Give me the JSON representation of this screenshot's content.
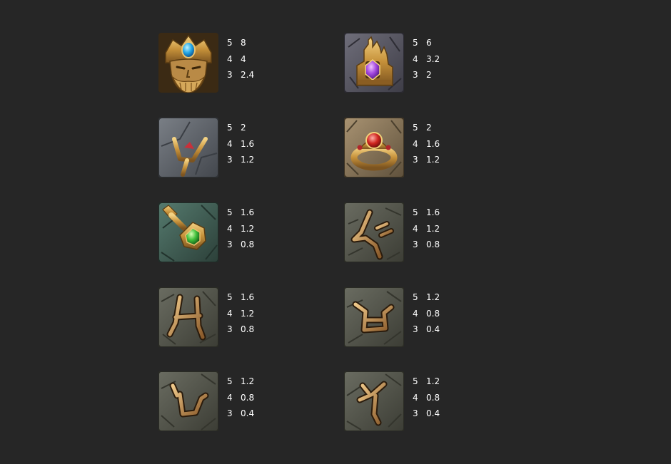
{
  "symbols": [
    {
      "icon": "poseidon-head-icon",
      "color": "#c9973a",
      "payouts": [
        {
          "count": "5",
          "value": "8"
        },
        {
          "count": "4",
          "value": "4"
        },
        {
          "count": "3",
          "value": "2.4"
        }
      ]
    },
    {
      "icon": "purple-gem-crown-icon",
      "color": "#9b5bd6",
      "payouts": [
        {
          "count": "5",
          "value": "6"
        },
        {
          "count": "4",
          "value": "3.2"
        },
        {
          "count": "3",
          "value": "2"
        }
      ]
    },
    {
      "icon": "trident-icon",
      "color": "#5e646b",
      "payouts": [
        {
          "count": "5",
          "value": "2"
        },
        {
          "count": "4",
          "value": "1.6"
        },
        {
          "count": "3",
          "value": "1.2"
        }
      ]
    },
    {
      "icon": "ruby-ring-icon",
      "color": "#8a7658",
      "payouts": [
        {
          "count": "5",
          "value": "2"
        },
        {
          "count": "4",
          "value": "1.6"
        },
        {
          "count": "3",
          "value": "1.2"
        }
      ]
    },
    {
      "icon": "emerald-key-icon",
      "color": "#3f5a52",
      "payouts": [
        {
          "count": "5",
          "value": "1.6"
        },
        {
          "count": "4",
          "value": "1.2"
        },
        {
          "count": "3",
          "value": "0.8"
        }
      ]
    },
    {
      "icon": "rune-stone-a-icon",
      "color": "#4d4f45",
      "payouts": [
        {
          "count": "5",
          "value": "1.6"
        },
        {
          "count": "4",
          "value": "1.2"
        },
        {
          "count": "3",
          "value": "0.8"
        }
      ]
    },
    {
      "icon": "rune-stone-h-icon",
      "color": "#4d4f45",
      "payouts": [
        {
          "count": "5",
          "value": "1.6"
        },
        {
          "count": "4",
          "value": "1.2"
        },
        {
          "count": "3",
          "value": "0.8"
        }
      ]
    },
    {
      "icon": "rune-stone-b-icon",
      "color": "#4d4f45",
      "payouts": [
        {
          "count": "5",
          "value": "1.2"
        },
        {
          "count": "4",
          "value": "0.8"
        },
        {
          "count": "3",
          "value": "0.4"
        }
      ]
    },
    {
      "icon": "rune-stone-u-icon",
      "color": "#4d4f45",
      "payouts": [
        {
          "count": "5",
          "value": "1.2"
        },
        {
          "count": "4",
          "value": "0.8"
        },
        {
          "count": "3",
          "value": "0.4"
        }
      ]
    },
    {
      "icon": "rune-stone-y-icon",
      "color": "#4d4f45",
      "payouts": [
        {
          "count": "5",
          "value": "1.2"
        },
        {
          "count": "4",
          "value": "0.8"
        },
        {
          "count": "3",
          "value": "0.4"
        }
      ]
    }
  ]
}
